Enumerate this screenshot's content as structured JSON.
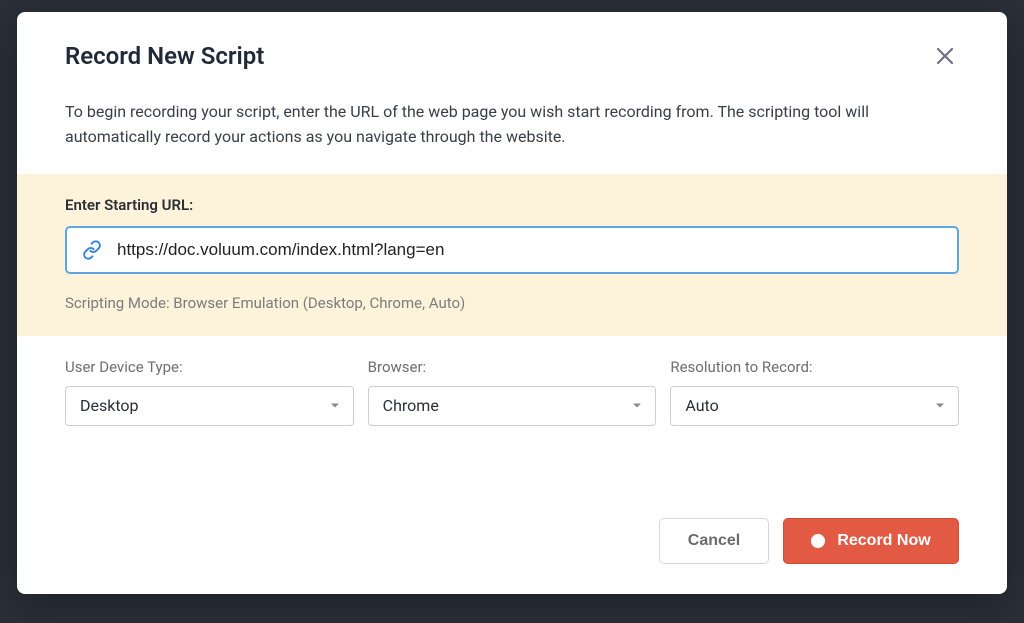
{
  "modal": {
    "title": "Record New Script",
    "description": "To begin recording your script, enter the URL of the web page you wish start recording from. The scripting tool will automatically record your actions as you navigate through the website."
  },
  "url_section": {
    "label": "Enter Starting URL:",
    "value": "https://doc.voluum.com/index.html?lang=en",
    "scripting_mode": "Scripting Mode: Browser Emulation (Desktop, Chrome, Auto)"
  },
  "options": {
    "device": {
      "label": "User Device Type:",
      "value": "Desktop"
    },
    "browser": {
      "label": "Browser:",
      "value": "Chrome"
    },
    "resolution": {
      "label": "Resolution to Record:",
      "value": "Auto"
    }
  },
  "footer": {
    "cancel": "Cancel",
    "record": "Record Now"
  }
}
